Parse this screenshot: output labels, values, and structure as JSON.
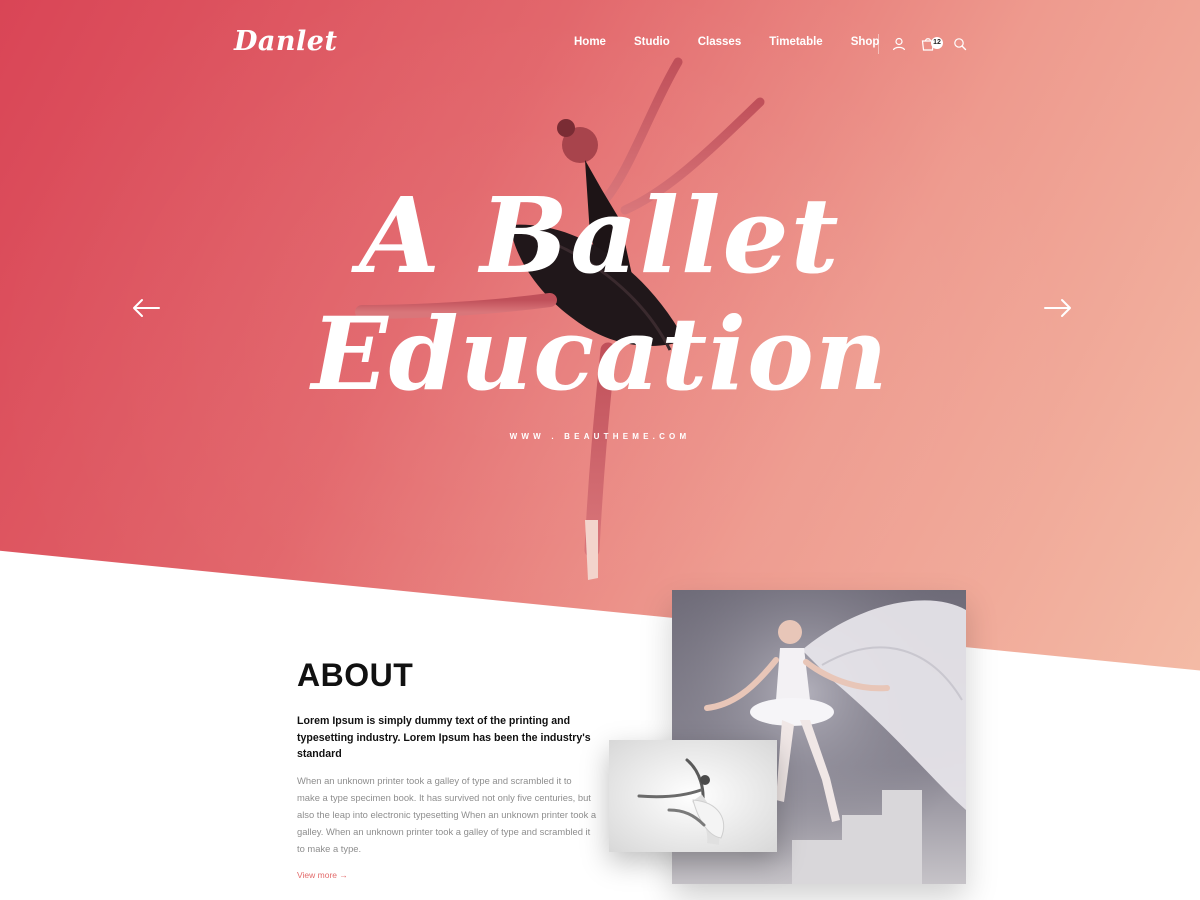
{
  "header": {
    "logo": "Danlet",
    "nav": [
      "Home",
      "Studio",
      "Classes",
      "Timetable",
      "Shop"
    ],
    "icons": [
      "user-icon",
      "cart-icon",
      "search-icon"
    ],
    "cart_count": "12"
  },
  "hero": {
    "title_line1": "A Ballet",
    "title_line2": "Education",
    "url": "WWW . BEAUTHEME.COM",
    "gradient": [
      "#d94556",
      "#e2656a",
      "#ee9a8e",
      "#f5c2ab"
    ]
  },
  "about": {
    "title": "ABOUT",
    "lead": "Lorem Ipsum is simply dummy text of the printing and typesetting industry. Lorem Ipsum has been the industry's standard",
    "body": "When an unknown printer took a galley of type and scrambled it to make a type specimen book. It has survived not only five centuries, but also the leap into electronic typesetting When an unknown printer took a galley. When an unknown printer took a galley of type and scrambled it to make a type.",
    "view_more": "View more  →"
  },
  "colors": {
    "accent": "#e36b6b",
    "heading": "#111111",
    "body_text": "#8e8e8e"
  }
}
